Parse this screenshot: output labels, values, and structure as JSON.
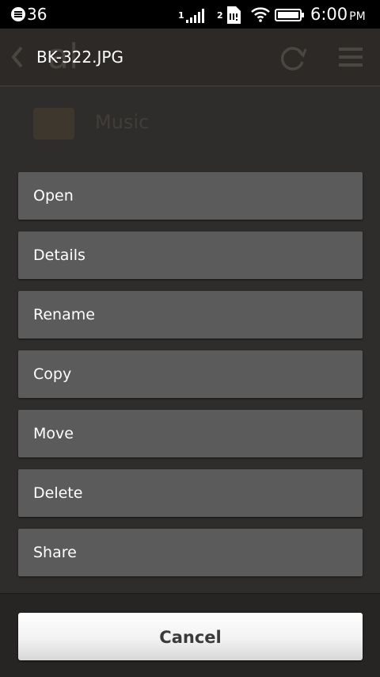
{
  "status_bar": {
    "notification_count": "36",
    "sim1_label": "1",
    "sim2_label": "2",
    "time": "6:00",
    "ampm": "PM",
    "icons": [
      "notification-icon",
      "signal-icon",
      "sim-card-icon",
      "wifi-icon",
      "battery-icon"
    ]
  },
  "background": {
    "title": "al",
    "item_label": "Music",
    "icons": [
      "back-icon",
      "refresh-icon",
      "menu-icon",
      "folder-icon"
    ]
  },
  "dialog": {
    "title": "BK-322.JPG",
    "items": [
      "Open",
      "Details",
      "Rename",
      "Copy",
      "Move",
      "Delete",
      "Share"
    ],
    "cancel_label": "Cancel"
  },
  "colors": {
    "menu_item_bg": "#5b5b5b",
    "backdrop": "#2b2a29",
    "cancel_bg": "#f2f2f2"
  }
}
